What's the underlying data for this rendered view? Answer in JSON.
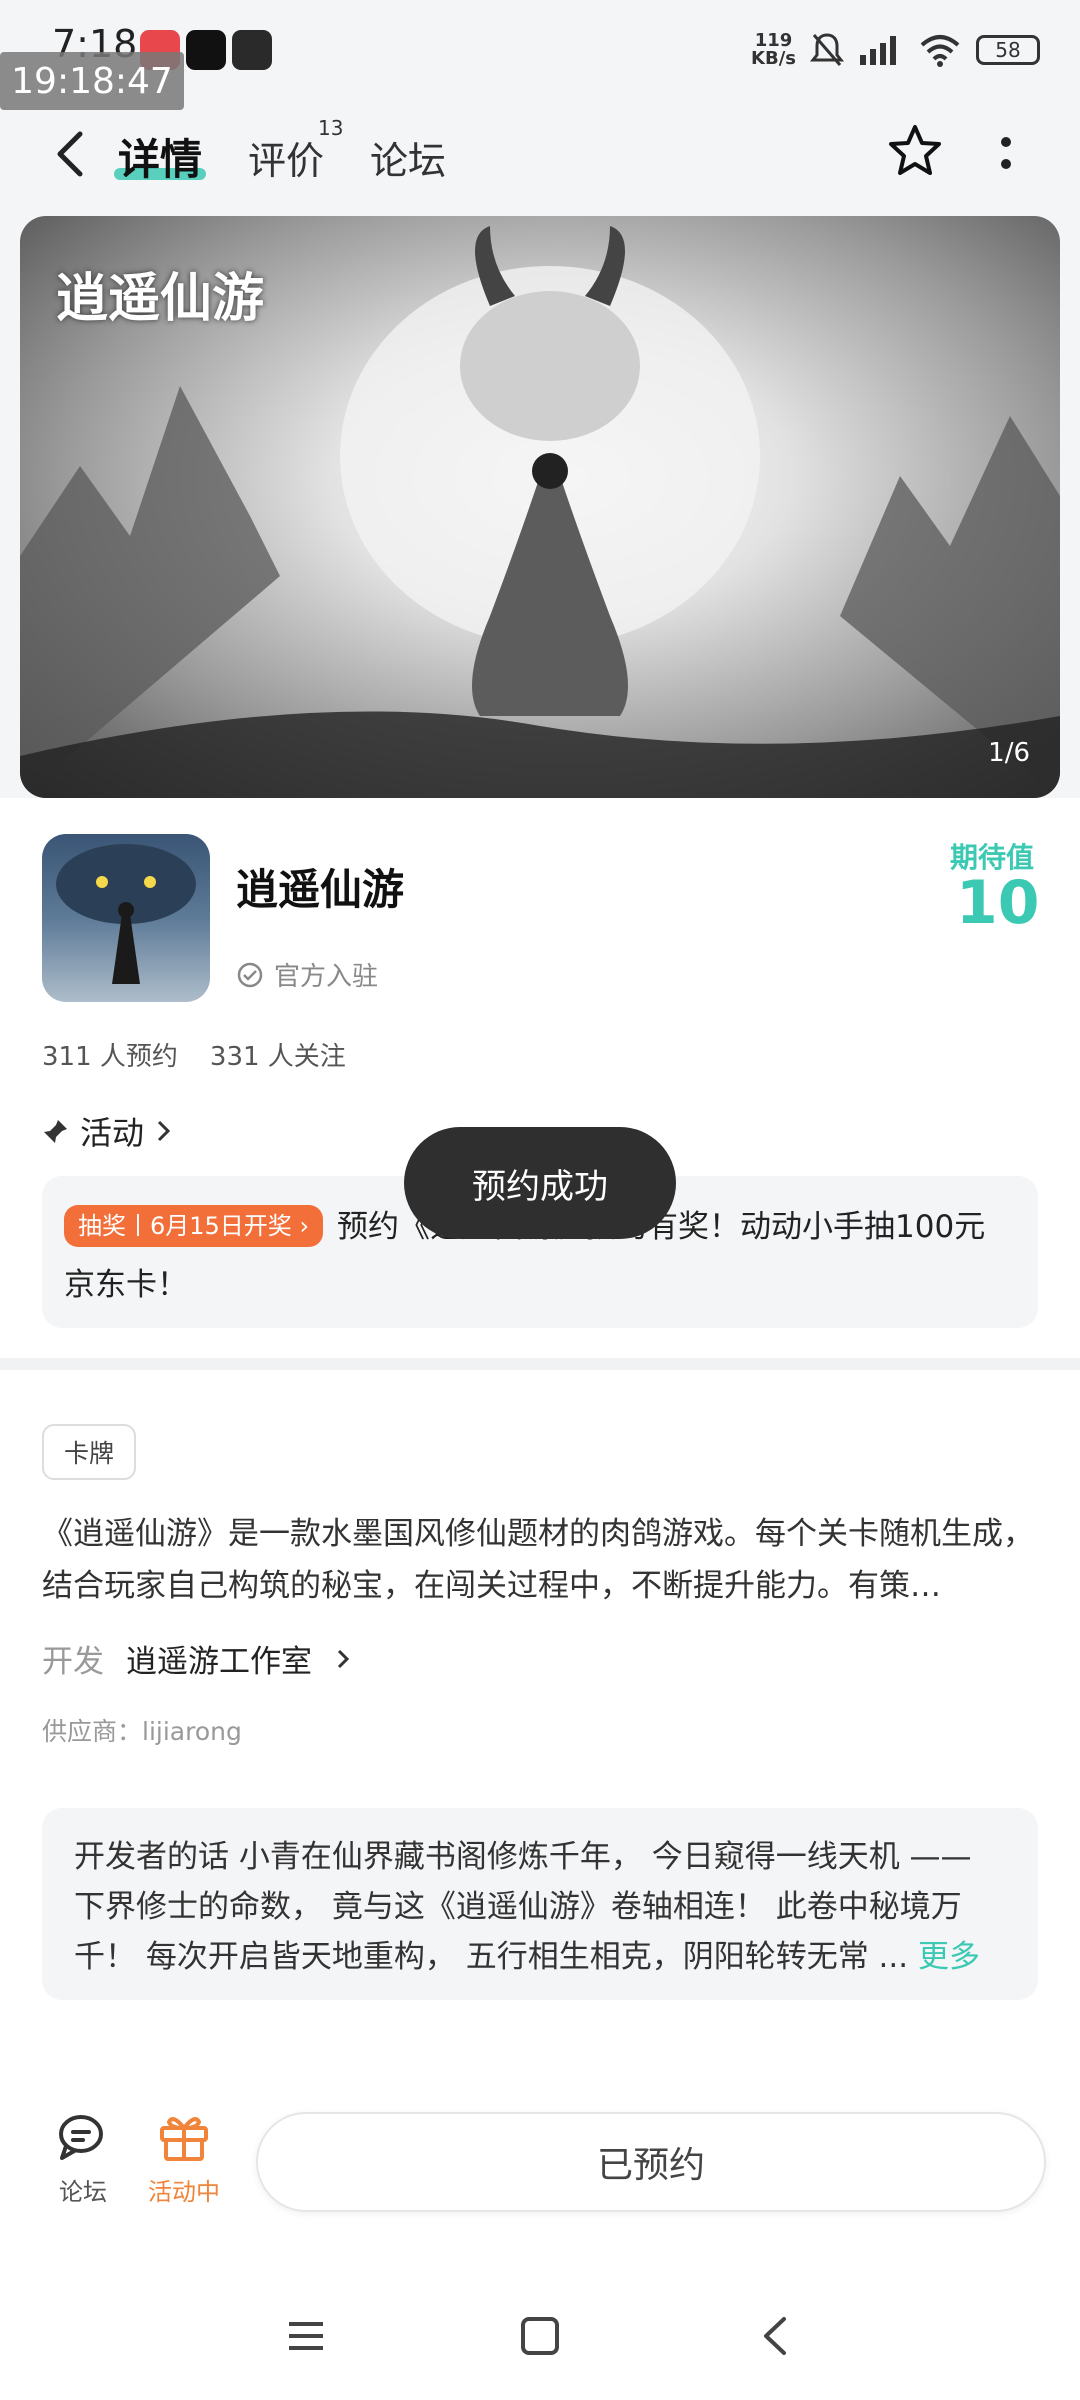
{
  "status_bar": {
    "time": "7:18",
    "clock_overlay": "19:18:47",
    "net_speed_value": "119",
    "net_speed_unit": "KB/s",
    "battery": "58"
  },
  "nav": {
    "tabs": [
      {
        "label": "详情"
      },
      {
        "label": "评价"
      },
      {
        "label": "论坛"
      }
    ],
    "review_count": "13"
  },
  "banner": {
    "counter": "1/6",
    "logo_text": "逍遥仙游"
  },
  "game": {
    "title": "逍遥仙游",
    "official_label": "官方入驻",
    "expect_label": "期待值",
    "expect_value": "10",
    "reservations": "311 人预约",
    "followers": "331 人关注"
  },
  "activity": {
    "heading": "活动",
    "tag": "抽奖丨6月15日开奖",
    "text": "预约《逍遥仙游》预约有奖！动动小手抽100元京东卡！"
  },
  "toast": "预约成功",
  "details": {
    "tag": "卡牌",
    "description": "《逍遥仙游》是一款水墨国风修仙题材的肉鸽游戏。每个关卡随机生成，结合玩家自己构筑的秘宝，在闯关过程中，不断提升能力。有策…",
    "developer_label": "开发",
    "developer_name": "逍遥游工作室",
    "supplier": "供应商：lijiarong",
    "dev_words": "开发者的话  小青在仙界藏书阁修炼千年， 今日窥得一线天机 —— 下界修士的命数， 竟与这《逍遥仙游》卷轴相连！ 此卷中秘境万千！ 每次开启皆天地重构， 五行相生相克，阴阳轮转无常 ...",
    "more": "更多"
  },
  "bottom": {
    "forum_label": "论坛",
    "activity_label": "活动中",
    "reserved_label": "已预约"
  },
  "colors": {
    "accent": "#3cc9b3",
    "lottery_tag": "#f26f3a",
    "gift": "#f0843a"
  }
}
